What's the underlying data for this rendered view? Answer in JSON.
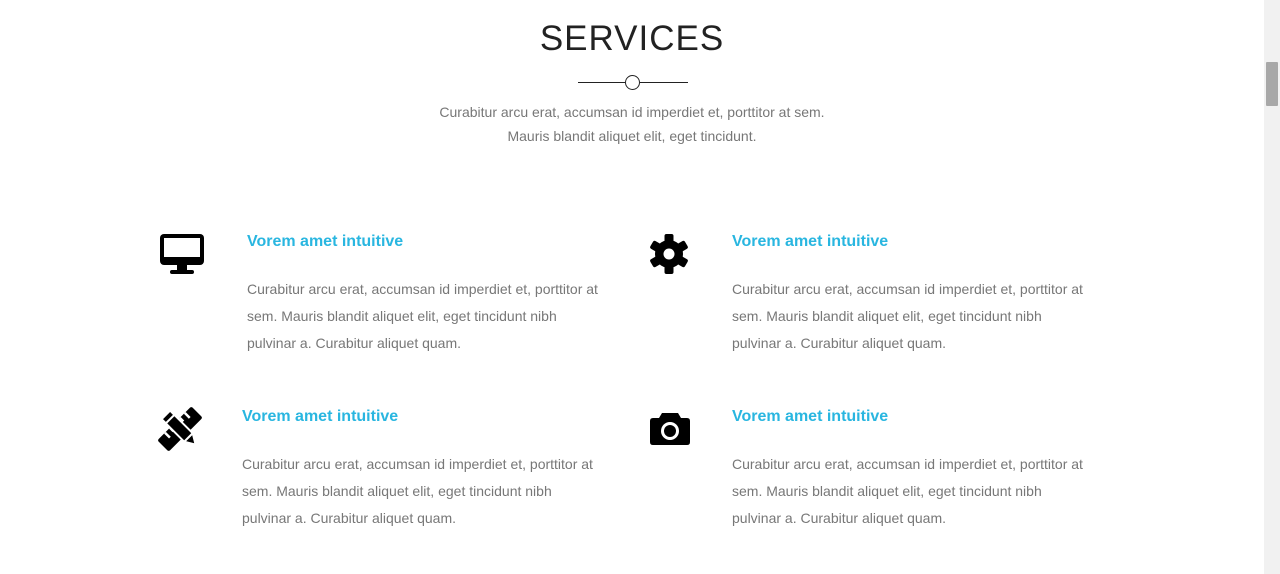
{
  "section": {
    "title": "SERVICES",
    "subtitle_line1": "Curabitur arcu erat, accumsan id imperdiet et, porttitor at sem.",
    "subtitle_line2": "Mauris blandit aliquet elit, eget tincidunt."
  },
  "services": [
    {
      "icon": "desktop-icon",
      "title": "Vorem amet intuitive",
      "desc_line1": "Curabitur arcu erat, accumsan id imperdiet et, porttitor at",
      "desc_line2": "sem. Mauris blandit aliquet elit, eget tincidunt nibh",
      "desc_line3": "pulvinar a. Curabitur aliquet quam."
    },
    {
      "icon": "gear-icon",
      "title": "Vorem amet intuitive",
      "desc_line1": "Curabitur arcu erat, accumsan id imperdiet et, porttitor at",
      "desc_line2": "sem. Mauris blandit aliquet elit, eget tincidunt nibh",
      "desc_line3": "pulvinar a. Curabitur aliquet quam."
    },
    {
      "icon": "pencil-ruler-icon",
      "title": "Vorem amet intuitive",
      "desc_line1": "Curabitur arcu erat, accumsan id imperdiet et, porttitor at",
      "desc_line2": "sem. Mauris blandit aliquet elit, eget tincidunt nibh",
      "desc_line3": "pulvinar a. Curabitur aliquet quam."
    },
    {
      "icon": "camera-icon",
      "title": "Vorem amet intuitive",
      "desc_line1": "Curabitur arcu erat, accumsan id imperdiet et, porttitor at",
      "desc_line2": "sem. Mauris blandit aliquet elit, eget tincidunt nibh",
      "desc_line3": "pulvinar a. Curabitur aliquet quam."
    }
  ],
  "colors": {
    "accent": "#29b6e0",
    "text": "#777777",
    "heading": "#222222"
  }
}
